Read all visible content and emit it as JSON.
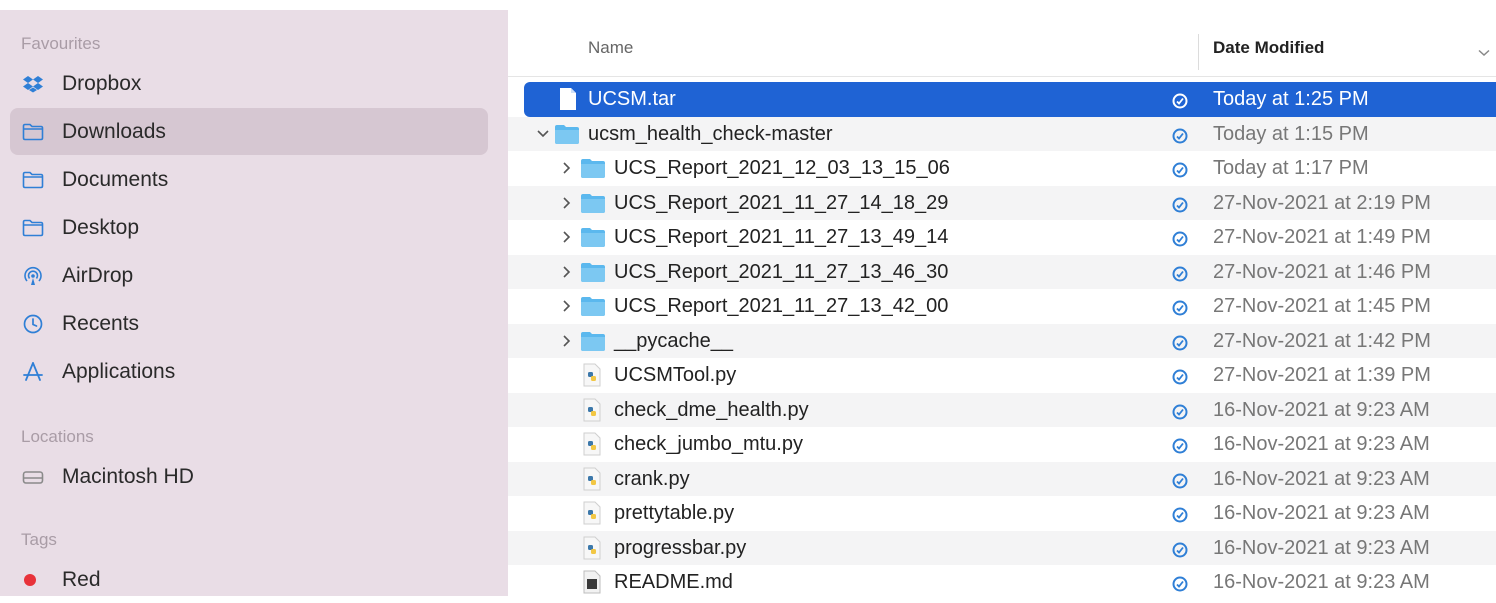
{
  "sidebar": {
    "favourites_heading": "Favourites",
    "favourites": [
      {
        "label": "Dropbox",
        "icon": "dropbox-icon"
      },
      {
        "label": "Downloads",
        "icon": "folder-icon",
        "selected": true
      },
      {
        "label": "Documents",
        "icon": "folder-icon"
      },
      {
        "label": "Desktop",
        "icon": "folder-icon"
      },
      {
        "label": "AirDrop",
        "icon": "airdrop-icon"
      },
      {
        "label": "Recents",
        "icon": "clock-icon"
      },
      {
        "label": "Applications",
        "icon": "applications-icon"
      }
    ],
    "locations_heading": "Locations",
    "locations": [
      {
        "label": "Macintosh HD",
        "icon": "drive-icon"
      }
    ],
    "tags_heading": "Tags",
    "tags": [
      {
        "label": "Red",
        "color": "#e8323a"
      }
    ]
  },
  "columns": {
    "name": "Name",
    "date_modified": "Date Modified"
  },
  "files": [
    {
      "name": "UCSM.tar",
      "date": "Today at 1:25 PM",
      "kind": "document",
      "selected": true
    },
    {
      "name": "ucsm_health_check-master",
      "date": "Today at 1:15 PM",
      "kind": "folder",
      "expanded": true
    },
    {
      "name": "UCS_Report_2021_12_03_13_15_06",
      "date": "Today at 1:17 PM",
      "kind": "folder"
    },
    {
      "name": "UCS_Report_2021_11_27_14_18_29",
      "date": "27-Nov-2021 at 2:19 PM",
      "kind": "folder"
    },
    {
      "name": "UCS_Report_2021_11_27_13_49_14",
      "date": "27-Nov-2021 at 1:49 PM",
      "kind": "folder"
    },
    {
      "name": "UCS_Report_2021_11_27_13_46_30",
      "date": "27-Nov-2021 at 1:46 PM",
      "kind": "folder"
    },
    {
      "name": "UCS_Report_2021_11_27_13_42_00",
      "date": "27-Nov-2021 at 1:45 PM",
      "kind": "folder"
    },
    {
      "name": "__pycache__",
      "date": "27-Nov-2021 at 1:42 PM",
      "kind": "folder"
    },
    {
      "name": "UCSMTool.py",
      "date": "27-Nov-2021 at 1:39 PM",
      "kind": "python"
    },
    {
      "name": "check_dme_health.py",
      "date": "16-Nov-2021 at 9:23 AM",
      "kind": "python"
    },
    {
      "name": "check_jumbo_mtu.py",
      "date": "16-Nov-2021 at 9:23 AM",
      "kind": "python"
    },
    {
      "name": "crank.py",
      "date": "16-Nov-2021 at 9:23 AM",
      "kind": "python"
    },
    {
      "name": "prettytable.py",
      "date": "16-Nov-2021 at 9:23 AM",
      "kind": "python"
    },
    {
      "name": "progressbar.py",
      "date": "16-Nov-2021 at 9:23 AM",
      "kind": "python"
    },
    {
      "name": "README.md",
      "date": "16-Nov-2021 at 9:23 AM",
      "kind": "markdown"
    }
  ],
  "colors": {
    "sidebar_bg": "#e9dde6",
    "selection": "#1f63d4",
    "folder": "#5bb8ee",
    "sync": "#2f7fd6"
  }
}
